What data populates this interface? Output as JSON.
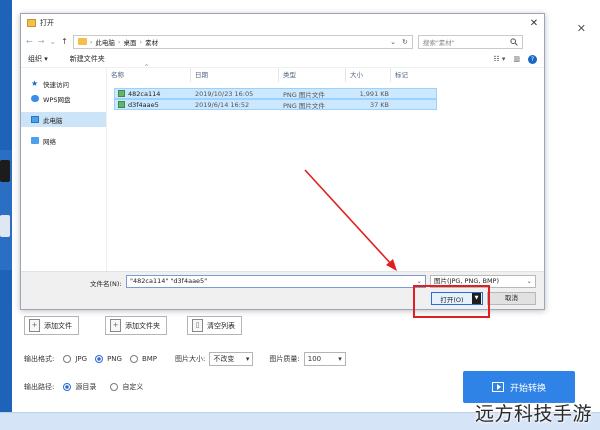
{
  "dialog": {
    "title": "打开",
    "close_glyph": "✕",
    "address": {
      "back": "←",
      "forward": "→",
      "dropdown": "⌄",
      "up": "↑",
      "path": [
        "此电脑",
        "桌面",
        "素材"
      ],
      "sep": "›",
      "refresh_dropdown": "⌄",
      "refresh": "↻"
    },
    "search_placeholder": "搜索\"素材\"",
    "search_icon": "search-icon",
    "toolbar": {
      "organize": "组织 ▾",
      "new_folder": "新建文件夹",
      "view": "☷ ▾",
      "pane": "▥",
      "help": "?"
    },
    "nav": [
      {
        "label": "快速访问",
        "icon": "star-icon"
      },
      {
        "label": "WPS网盘",
        "icon": "cloud-icon"
      },
      {
        "label": "此电脑",
        "icon": "pc-icon",
        "selected": true
      },
      {
        "label": "网络",
        "icon": "network-icon"
      }
    ],
    "columns": {
      "name": "名称",
      "date": "日期",
      "type": "类型",
      "size": "大小",
      "tag": "标记",
      "sort": "^"
    },
    "files": [
      {
        "name": "482ca114",
        "date": "2019/10/23 16:05",
        "type": "PNG 图片文件",
        "size": "1,991 KB"
      },
      {
        "name": "d3f4aae5",
        "date": "2019/6/14 16:52",
        "type": "PNG 图片文件",
        "size": "37 KB"
      }
    ],
    "filename_label": "文件名(N):",
    "filename_value": "\"482ca114\" \"d3f4aae5\"",
    "filetype_value": "图片(JPG, PNG, BMP)",
    "dd": "⌄",
    "open_label": "打开(O)",
    "open_split": "▼",
    "cancel_label": "取消"
  },
  "app": {
    "close_glyph": "✕",
    "buttons": {
      "add_file": "添加文件",
      "add_folder": "添加文件夹",
      "clear_list": "清空列表"
    },
    "output_format_label": "输出格式:",
    "formats": [
      {
        "label": "JPG",
        "checked": false
      },
      {
        "label": "PNG",
        "checked": true
      },
      {
        "label": "BMP",
        "checked": false
      }
    ],
    "image_size_label": "图片大小:",
    "image_size_value": "不改变",
    "quality_label": "图片质量:",
    "quality_value": "100",
    "output_path_label": "输出路径:",
    "paths": [
      {
        "label": "源目录",
        "checked": true
      },
      {
        "label": "自定义",
        "checked": false
      }
    ],
    "start_label": "开始转换"
  },
  "watermark": "远方科技手游",
  "colors": {
    "highlight": "#e02020",
    "accent": "#2f83e6",
    "selection": "#cce8ff"
  }
}
